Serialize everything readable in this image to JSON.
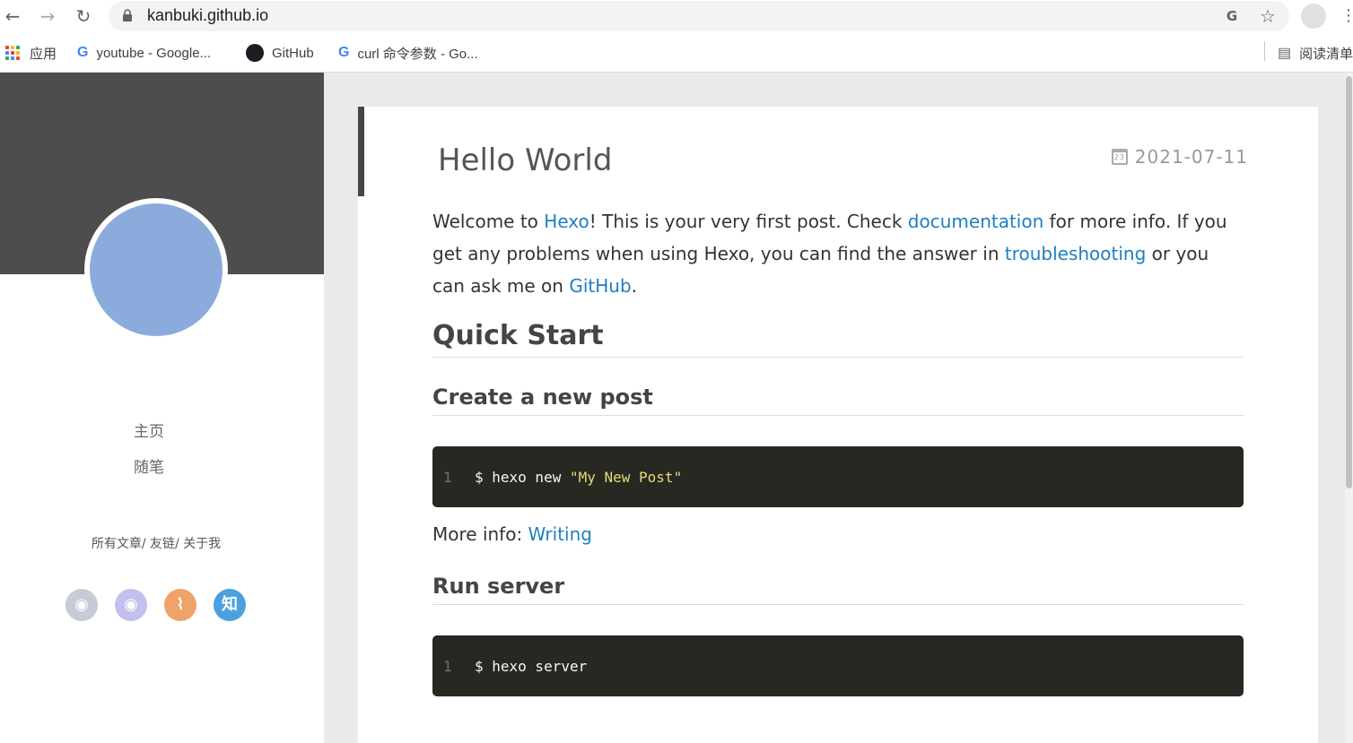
{
  "browser": {
    "url": "kanbuki.github.io",
    "bookmarks": [
      {
        "label": "应用"
      },
      {
        "label": "youtube - Google..."
      },
      {
        "label": "GitHub"
      },
      {
        "label": "curl 命令参数 - Go..."
      }
    ],
    "reading_list": "阅读清单",
    "icons": [
      "back-icon",
      "forward-icon",
      "reload-icon",
      "lock-icon",
      "translate-icon",
      "star-icon",
      "profile-icon",
      "more-icon"
    ]
  },
  "sidebar": {
    "nav": [
      "主页",
      "随笔"
    ],
    "sub_links": "所有文章/  友链/  关于我",
    "social": [
      {
        "icon": "github-icon",
        "color": "#c6cbd6"
      },
      {
        "icon": "weibo-icon",
        "color": "#c3bfef"
      },
      {
        "icon": "rss-icon",
        "color": "#f0a26b"
      },
      {
        "icon": "zhihu-icon",
        "color": "#4ba0e0",
        "glyph": "知"
      }
    ]
  },
  "post": {
    "title": "Hello World",
    "date": "2021-07-11",
    "intro": {
      "t1": "Welcome to ",
      "l1": "Hexo",
      "t2": "! This is your very first post. Check ",
      "l2": "documentation",
      "t3": " for more info. If you get any problems when using Hexo, you can find the answer in ",
      "l3": "troubleshooting",
      "t4": " or you can ask me on ",
      "l4": "GitHub",
      "t5": "."
    },
    "quick_start": "Quick Start",
    "create_post": "Create a new post",
    "code1": {
      "line": "1",
      "cmd": "$ hexo new ",
      "str": "\"My New Post\""
    },
    "more_info": "More info: ",
    "more_link": "Writing",
    "run_server": "Run server",
    "code2": {
      "line": "1",
      "cmd": "$ hexo server"
    }
  },
  "colors": {
    "link": "#1e7fc2",
    "banner": "#4d4d4d",
    "avatar": "#8aabdc",
    "code_bg": "#272822"
  }
}
